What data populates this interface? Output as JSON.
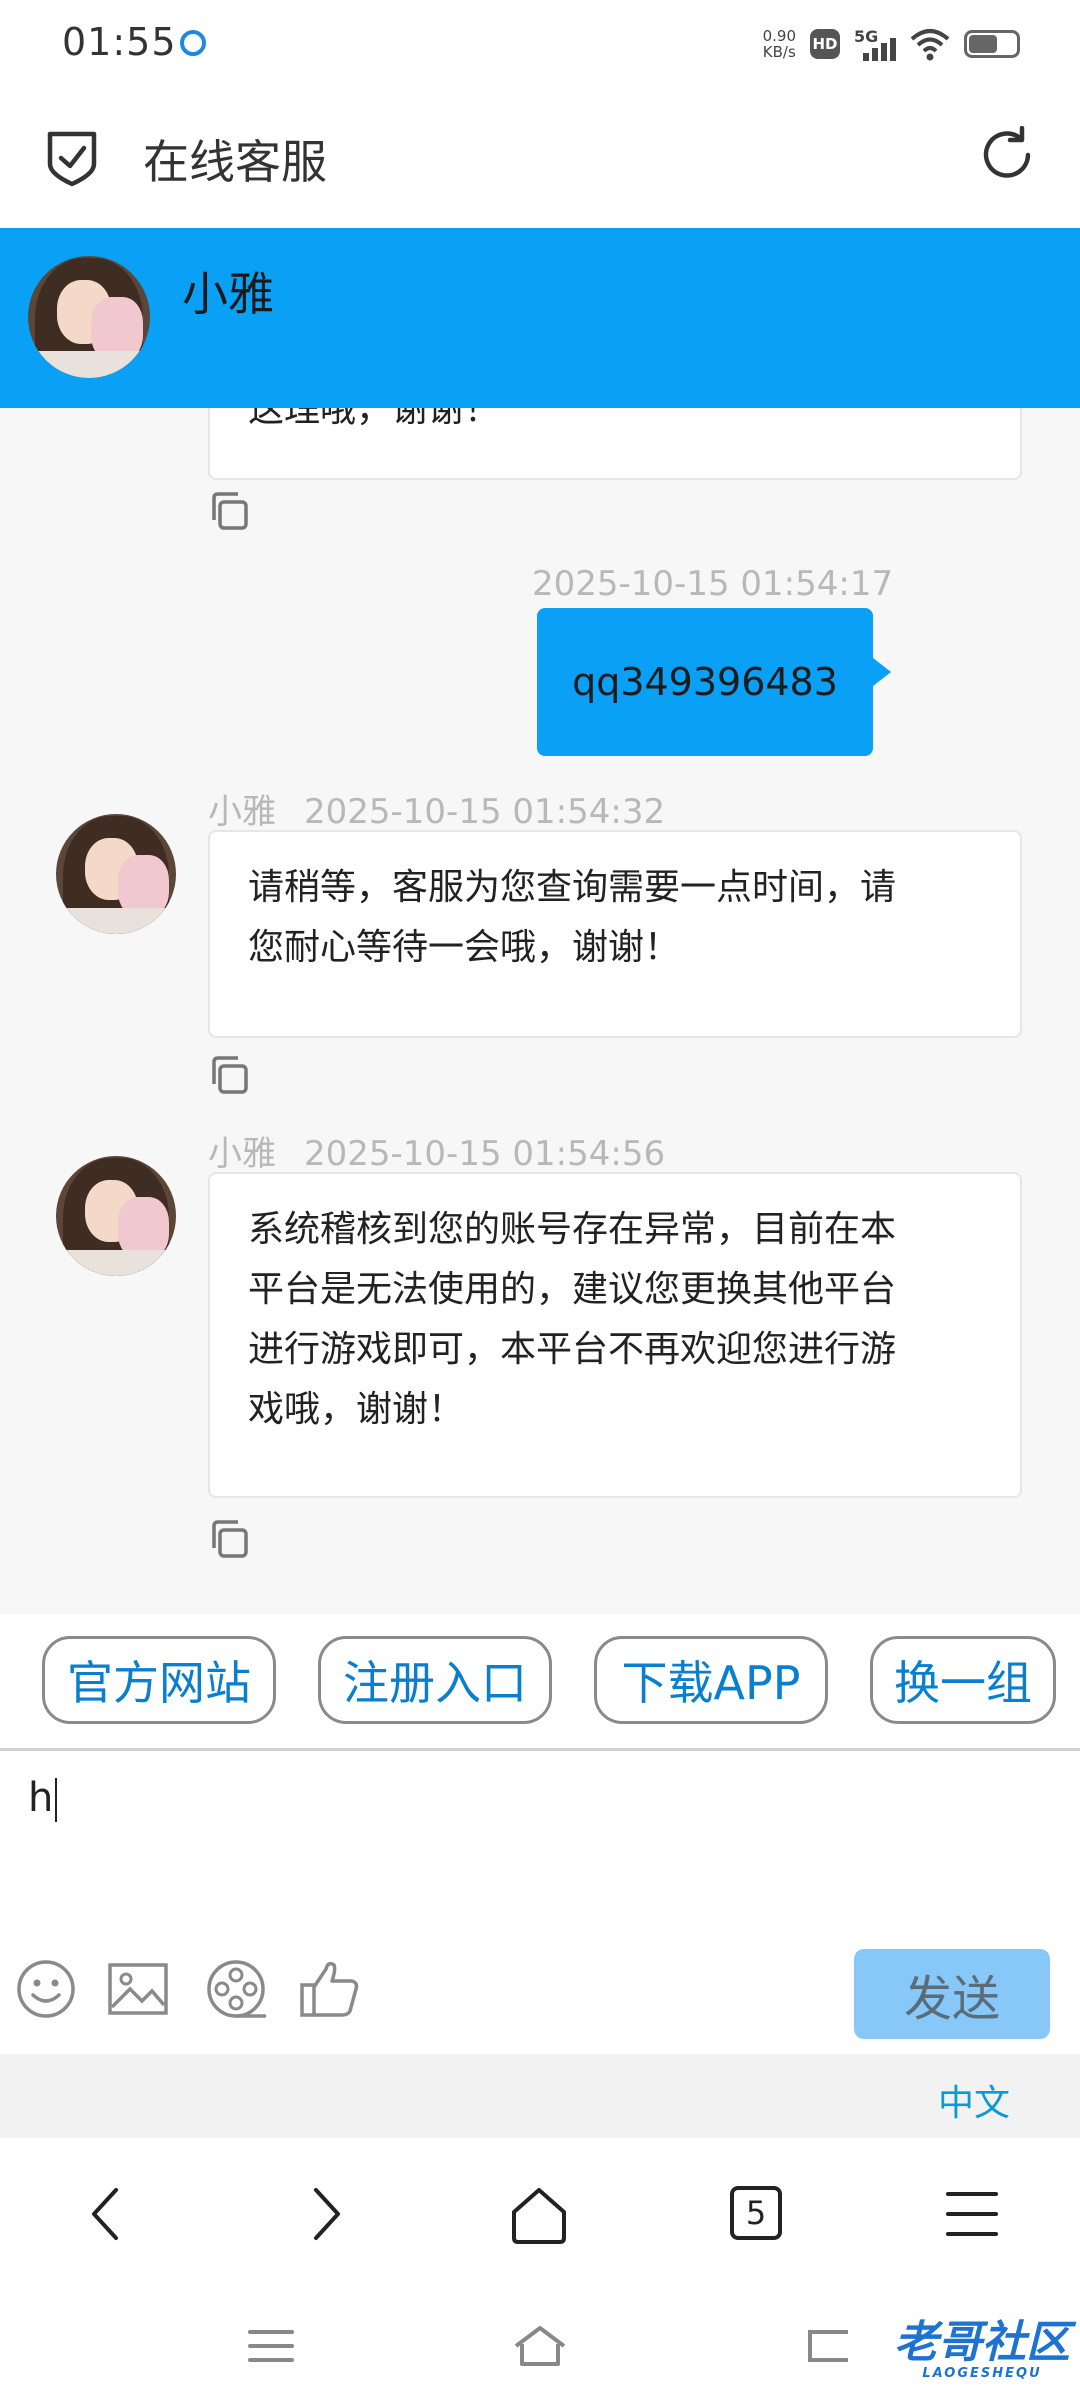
{
  "status_bar": {
    "time": "01:55",
    "net_speed_value": "0.90",
    "net_speed_unit": "KB/s",
    "hd_badge": "HD",
    "network_type": "5G",
    "battery_level": 0.55
  },
  "app_header": {
    "title": "在线客服",
    "left_icon": "shield-check-icon",
    "right_icon": "refresh-icon"
  },
  "chat_header": {
    "agent_name": "小雅"
  },
  "messages": [
    {
      "direction": "incoming",
      "text": "这理哦，谢谢！"
    },
    {
      "direction": "outgoing",
      "timestamp": "2025-10-15 01:54:17",
      "text": "qq349396483"
    },
    {
      "direction": "incoming",
      "sender": "小雅",
      "timestamp": "2025-10-15 01:54:32",
      "lines": [
        "请稍等，客服为您查询需要一点时间，请",
        "您耐心等待一会哦，谢谢！"
      ]
    },
    {
      "direction": "incoming",
      "sender": "小雅",
      "timestamp": "2025-10-15 01:54:56",
      "lines": [
        "系统稽核到您的账号存在异常，目前在本",
        "平台是无法使用的，建议您更换其他平台",
        "进行游戏即可，本平台不再欢迎您进行游",
        "戏哦，谢谢！"
      ]
    }
  ],
  "quick_buttons": [
    "官方网站",
    "注册入口",
    "下载APP",
    "换一组"
  ],
  "input": {
    "value": "h"
  },
  "toolbar_icons": [
    "smile-icon",
    "image-icon",
    "film-reel-icon",
    "thumbs-up-icon"
  ],
  "send_label": "发送",
  "language_label": "中文",
  "browser_nav": {
    "tab_count": "5"
  },
  "watermark": {
    "text": "老哥社区",
    "subtext": "LAOGESHEQU"
  },
  "colors": {
    "accent": "#0aa0f5",
    "send_disabled": "#88c8f8",
    "link": "#0a7fd0"
  }
}
